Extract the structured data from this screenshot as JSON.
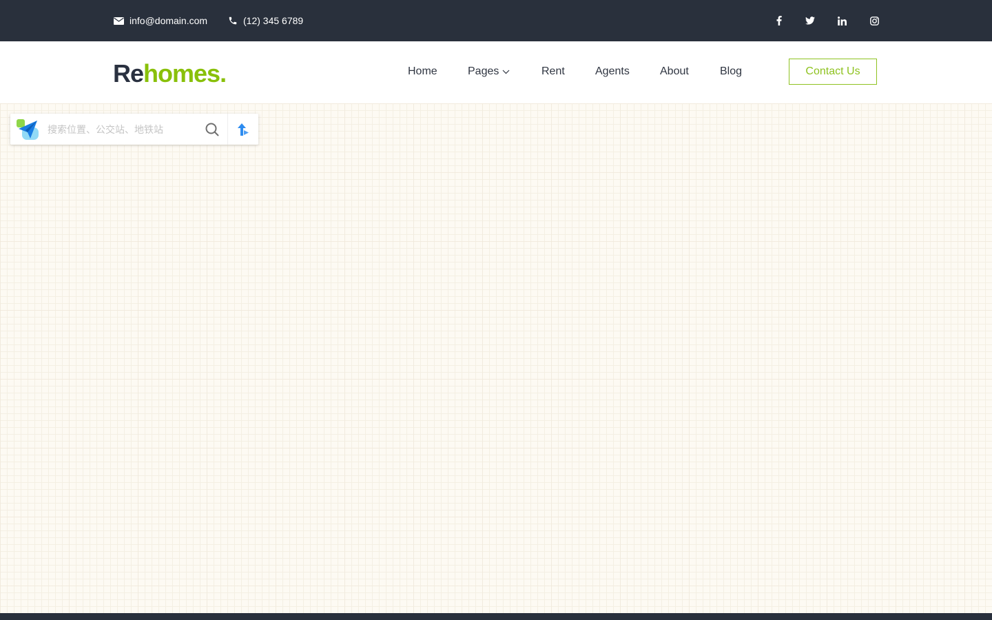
{
  "topbar": {
    "email": "info@domain.com",
    "phone": "(12) 345 6789",
    "email_icon": "envelope-icon",
    "phone_icon": "phone-icon",
    "social": [
      "facebook-icon",
      "twitter-icon",
      "linkedin-icon",
      "instagram-icon"
    ]
  },
  "header": {
    "logo_part1": "Re",
    "logo_part2": "homes.",
    "nav": {
      "home": "Home",
      "pages": "Pages",
      "rent": "Rent",
      "agents": "Agents",
      "about": "About",
      "blog": "Blog"
    },
    "contact_button": "Contact Us"
  },
  "map": {
    "search_placeholder": "搜索位置、公交站、地铁站"
  },
  "colors": {
    "dark": "#29303c",
    "accent": "#89c00a",
    "map_bg": "#fdfaf3"
  }
}
